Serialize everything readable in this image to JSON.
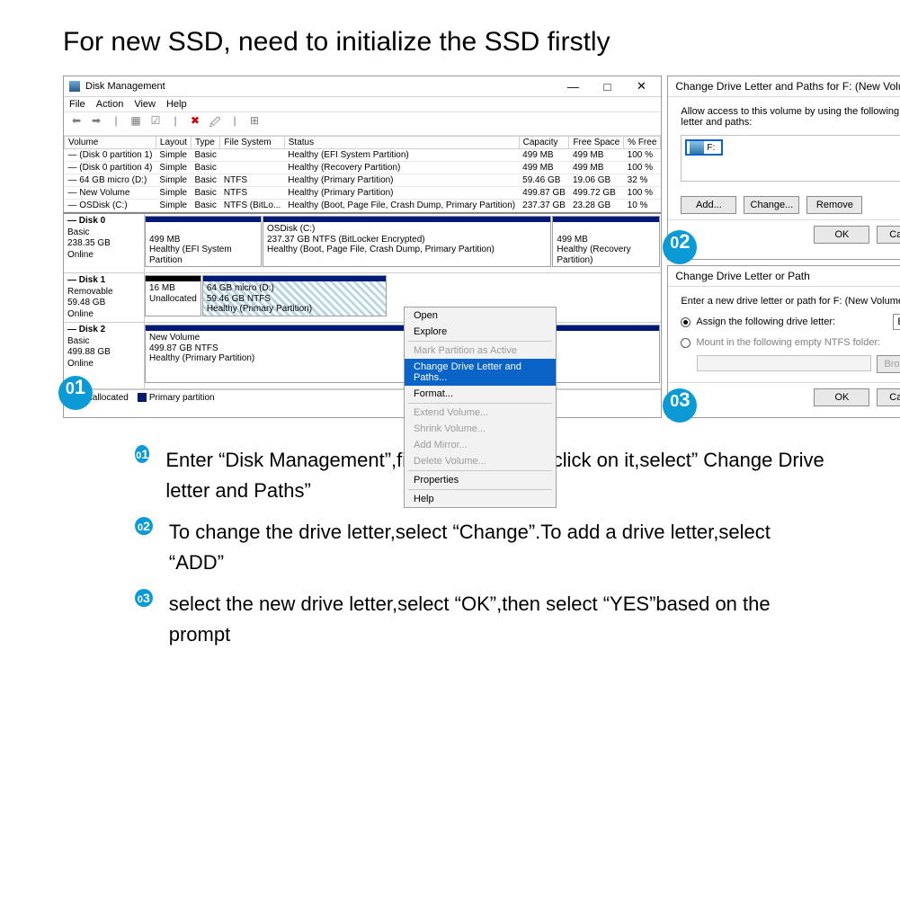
{
  "headline": "For new SSD, need to initialize the SSD firstly",
  "window1": {
    "title": "Disk Management",
    "menus": [
      "File",
      "Action",
      "View",
      "Help"
    ],
    "columns": [
      "Volume",
      "Layout",
      "Type",
      "File System",
      "Status",
      "Capacity",
      "Free Space",
      "% Free"
    ],
    "volumes": [
      {
        "vol": "— (Disk 0 partition 1)",
        "layout": "Simple",
        "type": "Basic",
        "fs": "",
        "status": "Healthy (EFI System Partition)",
        "cap": "499 MB",
        "free": "499 MB",
        "pct": "100 %"
      },
      {
        "vol": "— (Disk 0 partition 4)",
        "layout": "Simple",
        "type": "Basic",
        "fs": "",
        "status": "Healthy (Recovery Partition)",
        "cap": "499 MB",
        "free": "499 MB",
        "pct": "100 %"
      },
      {
        "vol": "— 64 GB micro (D:)",
        "layout": "Simple",
        "type": "Basic",
        "fs": "NTFS",
        "status": "Healthy (Primary Partition)",
        "cap": "59.46 GB",
        "free": "19.06 GB",
        "pct": "32 %"
      },
      {
        "vol": "— New Volume",
        "layout": "Simple",
        "type": "Basic",
        "fs": "NTFS",
        "status": "Healthy (Primary Partition)",
        "cap": "499.87 GB",
        "free": "499.72 GB",
        "pct": "100 %"
      },
      {
        "vol": "— OSDisk (C:)",
        "layout": "Simple",
        "type": "Basic",
        "fs": "NTFS (BitLo...",
        "status": "Healthy (Boot, Page File, Crash Dump, Primary Partition)",
        "cap": "237.37 GB",
        "free": "23.28 GB",
        "pct": "10 %"
      }
    ],
    "disk0": {
      "name": "— Disk 0",
      "kind": "Basic",
      "size": "238.35 GB",
      "state": "Online",
      "p1_size": "499 MB",
      "p1_status": "Healthy (EFI System Partition",
      "p2_name": "OSDisk (C:)",
      "p2_size": "237.37 GB NTFS (BitLocker Encrypted)",
      "p2_status": "Healthy (Boot, Page File, Crash Dump, Primary Partition)",
      "p3_size": "499 MB",
      "p3_status": "Healthy (Recovery Partition)"
    },
    "disk1": {
      "name": "— Disk 1",
      "kind": "Removable",
      "size": "59.48 GB",
      "state": "Online",
      "p0_size": "16 MB",
      "p0_status": "Unallocated",
      "p1_name": "64 GB micro  (D:)",
      "p1_size": "59.46 GB NTFS",
      "p1_status": "Healthy (Primary Partition)"
    },
    "disk2": {
      "name": "— Disk 2",
      "kind": "Basic",
      "size": "499.88 GB",
      "state": "Online",
      "p1_name": "New Volume",
      "p1_size": "499.87 GB NTFS",
      "p1_status": "Healthy (Primary Partition)"
    },
    "legend": {
      "unalloc": "Unallocated",
      "primary": "Primary partition"
    },
    "context_menu": {
      "open": "Open",
      "explore": "Explore",
      "mark": "Mark Partition as Active",
      "change": "Change Drive Letter and Paths...",
      "format": "Format...",
      "extend": "Extend Volume...",
      "shrink": "Shrink Volume...",
      "mirror": "Add Mirror...",
      "delete": "Delete Volume...",
      "props": "Properties",
      "help": "Help"
    }
  },
  "window2": {
    "title": "Change Drive Letter and Paths for F: (New Volume)",
    "msg": "Allow access to this volume by using the following drive letter and paths:",
    "chip": "F:",
    "add": "Add...",
    "change": "Change...",
    "remove": "Remove",
    "ok": "OK",
    "cancel": "Cancel"
  },
  "window3": {
    "title": "Change Drive Letter or Path",
    "msg": "Enter a new drive letter or path for F: (New Volume).",
    "opt1": "Assign the following drive letter:",
    "opt2": "Mount in the following empty NTFS folder:",
    "letter": "E",
    "browse": "Browse...",
    "ok": "OK",
    "cancel": "Cancel"
  },
  "steps": {
    "s1n": "01",
    "s1": "Enter “Disk Management”,find the disk,right-click on it,select” Change Drive letter and Paths”",
    "s2n": "02",
    "s2": "To change the drive letter,select “Change”.To add a drive letter,select “ADD”",
    "s3n": "03",
    "s3": "select the new drive letter,select “OK”,then select “YES”based on the prompt"
  }
}
